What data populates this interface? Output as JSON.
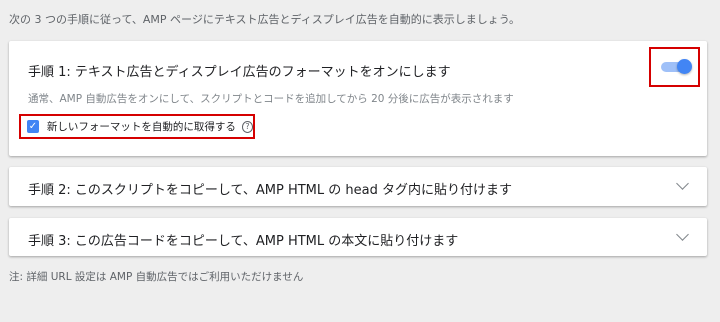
{
  "intro": "次の 3 つの手順に従って、AMP ページにテキスト広告とディスプレイ広告を自動的に表示しましょう。",
  "step1": {
    "title": "手順 1: テキスト広告とディスプレイ広告のフォーマットをオンにします",
    "toggle_on": true,
    "description": "通常、AMP 自動広告をオンにして、スクリプトとコードを追加してから 20 分後に広告が表示されます",
    "checkbox_checked": true,
    "checkbox_label": "新しいフォーマットを自動的に取得する",
    "help_glyph": "?"
  },
  "step2": {
    "title": "手順 2: このスクリプトをコピーして、AMP HTML の head タグ内に貼り付けます"
  },
  "step3": {
    "title": "手順 3: この広告コードをコピーして、AMP HTML の本文に貼り付けます"
  },
  "note": "注: 詳細 URL 設定は AMP 自動広告ではご利用いただけません",
  "colors": {
    "accent": "#4285f4",
    "highlight_border": "#d50000",
    "background": "#eeeeee"
  }
}
